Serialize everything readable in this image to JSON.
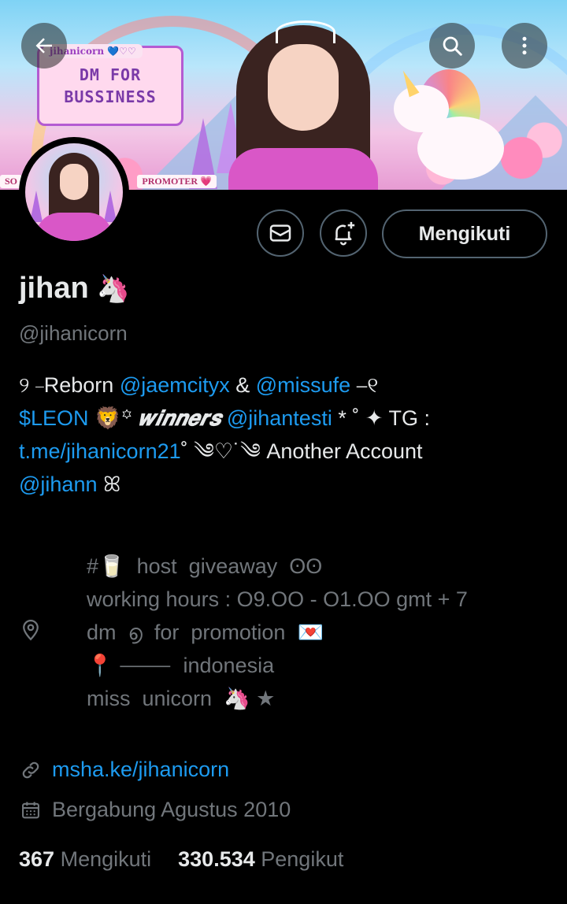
{
  "banner": {
    "sign_top": "jihanicorn 💙♡♡",
    "sign_line1": "DM FOR",
    "sign_line2": "BUSSINESS",
    "strip_left": "SO",
    "strip_right": "PROMOTER 💗"
  },
  "header": {
    "back_icon": "arrow-left-icon",
    "search_icon": "search-icon",
    "more_icon": "more-vertical-icon"
  },
  "actions": {
    "message_icon": "envelope-icon",
    "notify_icon": "bell-plus-icon",
    "follow_label": "Mengikuti"
  },
  "profile": {
    "name": "jihan",
    "name_emoji": "🦄",
    "handle": "@jihanicorn",
    "bio": {
      "line1_a": "୨ ⎯Reborn ",
      "line1_m1": "@jaemcityx",
      "line1_b": " & ",
      "line1_m2": "@missufe",
      "line1_c": " ⎯୧",
      "line2_cash": "$LEON",
      "line2_b": " 🦁꙳ ",
      "line2_win": "𝒘𝒊𝒏𝒏𝒆𝒓𝒔",
      "line2_space": " ",
      "line2_m": "@jihantesti",
      "line2_c": " * ˚ ✦ TG :",
      "line3_link": "t.me/jihanicorn21",
      "line3_b": "˚ ༄♡˙༄ Another Account",
      "line4_m": "@jihann",
      "line4_b": " ꕤ"
    },
    "location": "#🥛  host  giveaway  ʘʘ\nworking hours : O9.OO - O1.OO gmt + 7\ndm  ൭  for  promotion  💌\n📍 ⸻  indonesia\nmiss  unicorn  🦄 ★",
    "location_icon": "location-pin-icon",
    "website": "msha.ke/jihanicorn",
    "website_icon": "link-icon",
    "joined": "Bergabung Agustus 2010",
    "joined_icon": "calendar-icon",
    "following_count": "367",
    "following_label": "Mengikuti",
    "followers_count": "330.534",
    "followers_label": "Pengikut"
  },
  "colors": {
    "background": "#000000",
    "text": "#e7e9ea",
    "muted": "#71767b",
    "link": "#1d9bf0",
    "border": "#536471"
  }
}
